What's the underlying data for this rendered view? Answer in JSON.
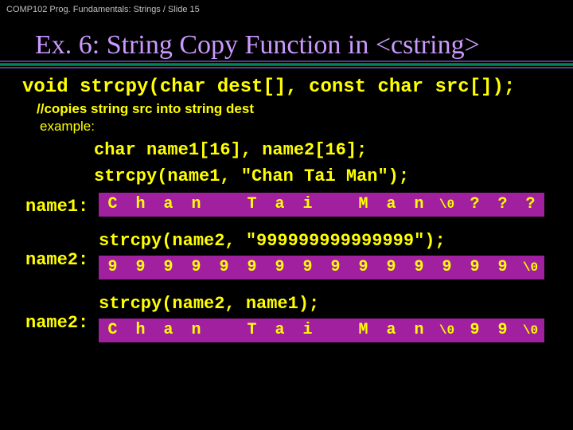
{
  "header": "COMP102 Prog. Fundamentals: Strings / Slide 15",
  "title": "Ex. 6: String Copy Function in <cstring>",
  "signature": "void strcpy(char dest[], const char src[]);",
  "comment": "//copies string src into string dest",
  "example_label": "example:",
  "decl": "char name1[16], name2[16];",
  "stmt1": "strcpy(name1, \"Chan Tai Man\");",
  "label_name1": "name1:",
  "arr1": [
    "C",
    "h",
    "a",
    "n",
    "",
    "T",
    "a",
    "i",
    "",
    "M",
    "a",
    "n",
    "\\0",
    "?",
    "?",
    "?"
  ],
  "stmt2": "strcpy(name2, \"999999999999999\");",
  "label_name2_a": "name2:",
  "arr2": [
    "9",
    "9",
    "9",
    "9",
    "9",
    "9",
    "9",
    "9",
    "9",
    "9",
    "9",
    "9",
    "9",
    "9",
    "9",
    "\\0"
  ],
  "stmt3": "strcpy(name2, name1);",
  "label_name2_b": "name2:",
  "arr3": [
    "C",
    "h",
    "a",
    "n",
    "",
    "T",
    "a",
    "i",
    "",
    "M",
    "a",
    "n",
    "\\0",
    "9",
    "9",
    "\\0"
  ]
}
